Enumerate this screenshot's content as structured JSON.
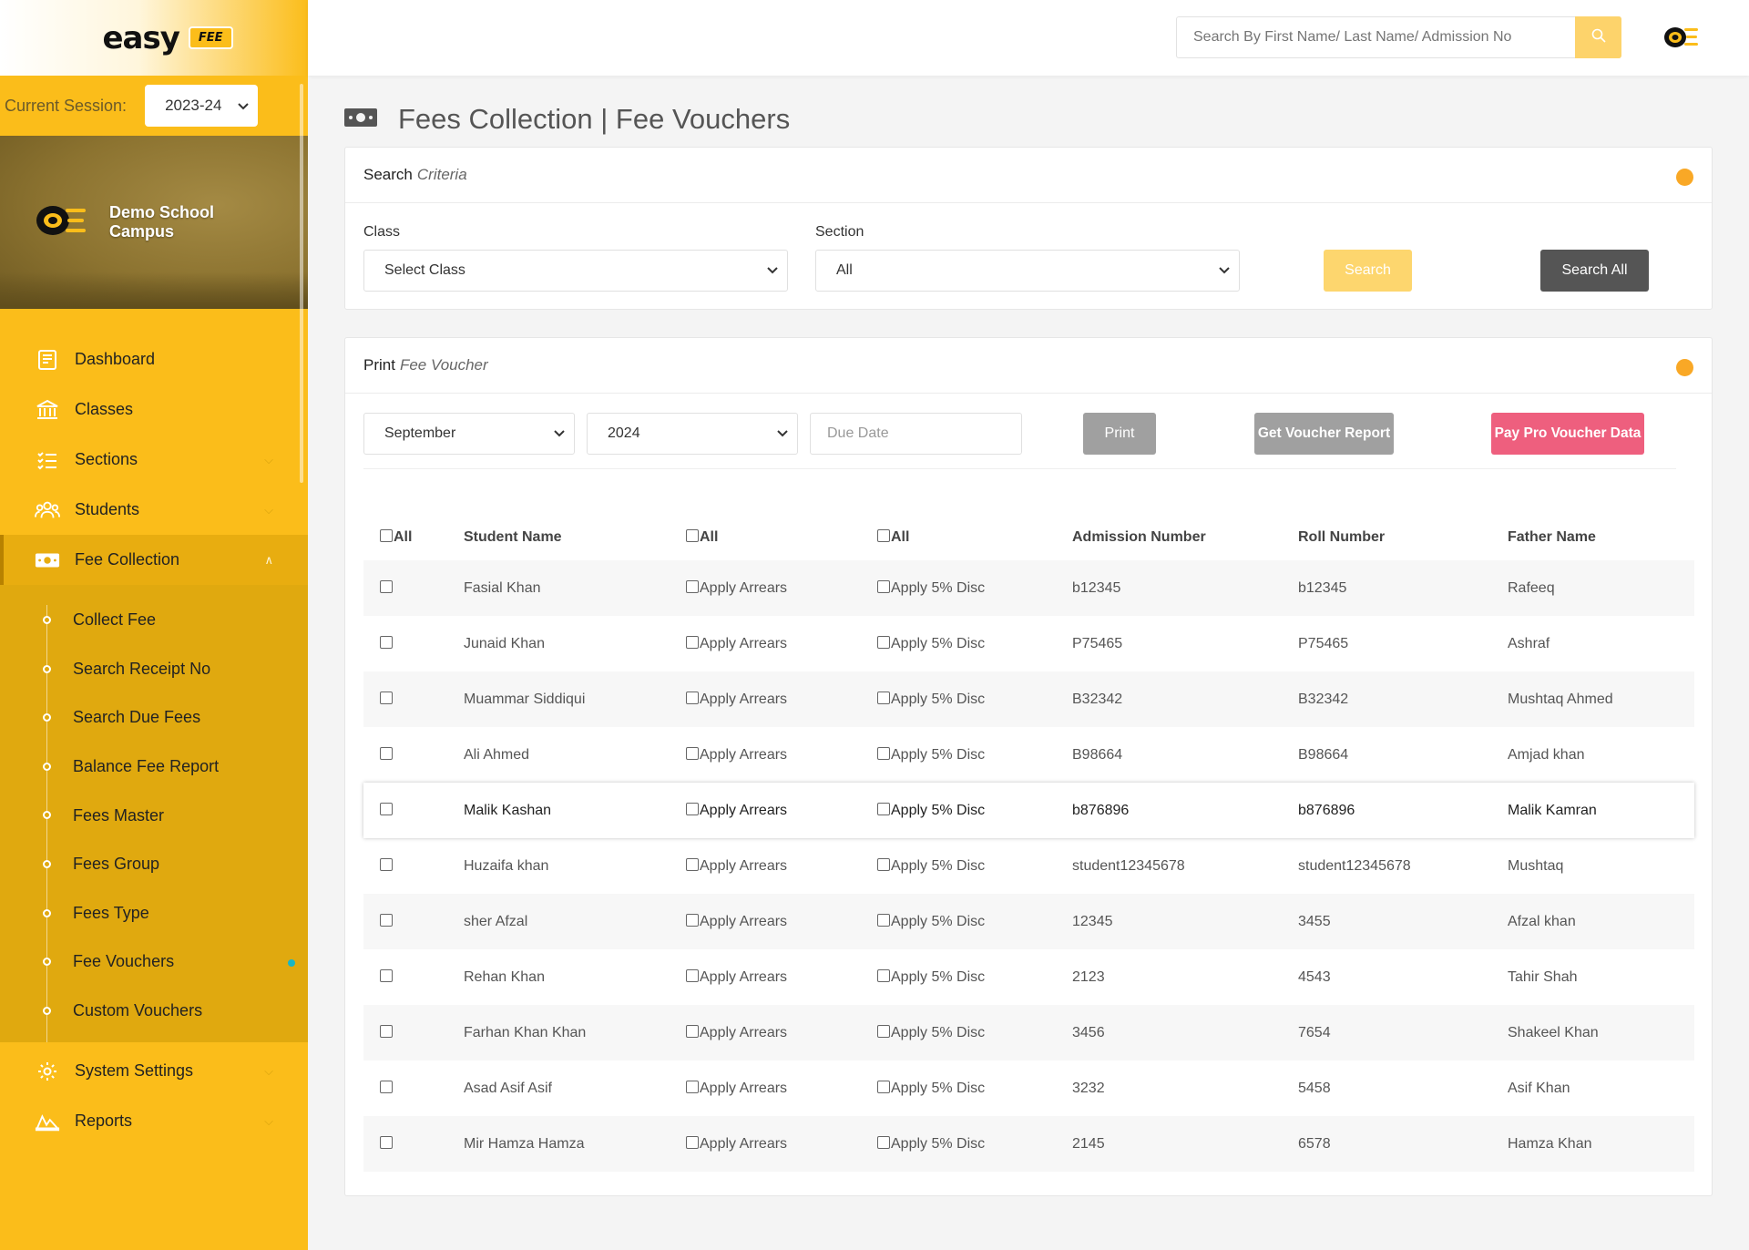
{
  "brand": {
    "word": "easy",
    "badge": "FEE"
  },
  "session": {
    "label": "Current Session:",
    "value": "2023-24"
  },
  "campus": {
    "name": "Demo School Campus"
  },
  "nav": {
    "items": [
      {
        "label": "Dashboard",
        "icon": "dashboard-icon"
      },
      {
        "label": "Classes",
        "icon": "bank-icon"
      },
      {
        "label": "Sections",
        "icon": "list-icon"
      },
      {
        "label": "Students",
        "icon": "users-icon"
      },
      {
        "label": "Fee Collection",
        "icon": "money-icon"
      }
    ],
    "fee_sub": [
      {
        "label": "Collect Fee"
      },
      {
        "label": "Search Receipt No"
      },
      {
        "label": "Search Due Fees"
      },
      {
        "label": "Balance Fee Report"
      },
      {
        "label": "Fees Master"
      },
      {
        "label": "Fees Group"
      },
      {
        "label": "Fees Type"
      },
      {
        "label": "Fee Vouchers"
      },
      {
        "label": "Custom Vouchers"
      }
    ],
    "bottom": [
      {
        "label": "System Settings",
        "icon": "gear-icon"
      },
      {
        "label": "Reports",
        "icon": "reports-icon"
      }
    ]
  },
  "topbar": {
    "search_placeholder": "Search By First Name/ Last Name/ Admission No"
  },
  "page": {
    "title": "Fees Collection | Fee Vouchers"
  },
  "search_card": {
    "title": "Search",
    "subtitle": "Criteria",
    "class_label": "Class",
    "class_value": "Select Class",
    "section_label": "Section",
    "section_value": "All",
    "search_button": "Search",
    "search_all_button": "Search All"
  },
  "print_card": {
    "title": "Print",
    "subtitle": "Fee Voucher",
    "month": "September",
    "year": "2024",
    "due_date_placeholder": "Due Date",
    "print_button": "Print",
    "report_button": "Get Voucher Report",
    "paypro_button": "Pay Pro Voucher Data"
  },
  "table": {
    "all_label": "All",
    "headers": [
      "Student Name",
      "Admission Number",
      "Roll Number",
      "Father Name"
    ],
    "arrears_label": "Apply Arrears",
    "disc_label": "Apply 5% Disc",
    "rows": [
      {
        "name": "Fasial Khan",
        "admission": "b12345",
        "roll": "b12345",
        "father": "Rafeeq"
      },
      {
        "name": "Junaid Khan",
        "admission": "P75465",
        "roll": "P75465",
        "father": "Ashraf"
      },
      {
        "name": "Muammar Siddiqui",
        "admission": "B32342",
        "roll": "B32342",
        "father": "Mushtaq Ahmed"
      },
      {
        "name": "Ali Ahmed",
        "admission": "B98664",
        "roll": "B98664",
        "father": "Amjad khan"
      },
      {
        "name": "Malik Kashan",
        "admission": "b876896",
        "roll": "b876896",
        "father": "Malik Kamran"
      },
      {
        "name": "Huzaifa khan",
        "admission": "student12345678",
        "roll": "student12345678",
        "father": "Mushtaq"
      },
      {
        "name": "sher Afzal",
        "admission": "12345",
        "roll": "3455",
        "father": "Afzal khan"
      },
      {
        "name": "Rehan Khan",
        "admission": "2123",
        "roll": "4543",
        "father": "Tahir Shah"
      },
      {
        "name": "Farhan Khan Khan",
        "admission": "3456",
        "roll": "7654",
        "father": "Shakeel Khan"
      },
      {
        "name": "Asad Asif Asif",
        "admission": "3232",
        "roll": "5458",
        "father": "Asif Khan"
      },
      {
        "name": "Mir Hamza Hamza",
        "admission": "2145",
        "roll": "6578",
        "father": "Hamza Khan"
      }
    ]
  },
  "colors": {
    "accent": "#fbbd1a",
    "dark_button": "#555555",
    "paypro": "#ee5f7e",
    "orb": "#f9a826",
    "grey_button": "#a0a0a0"
  }
}
